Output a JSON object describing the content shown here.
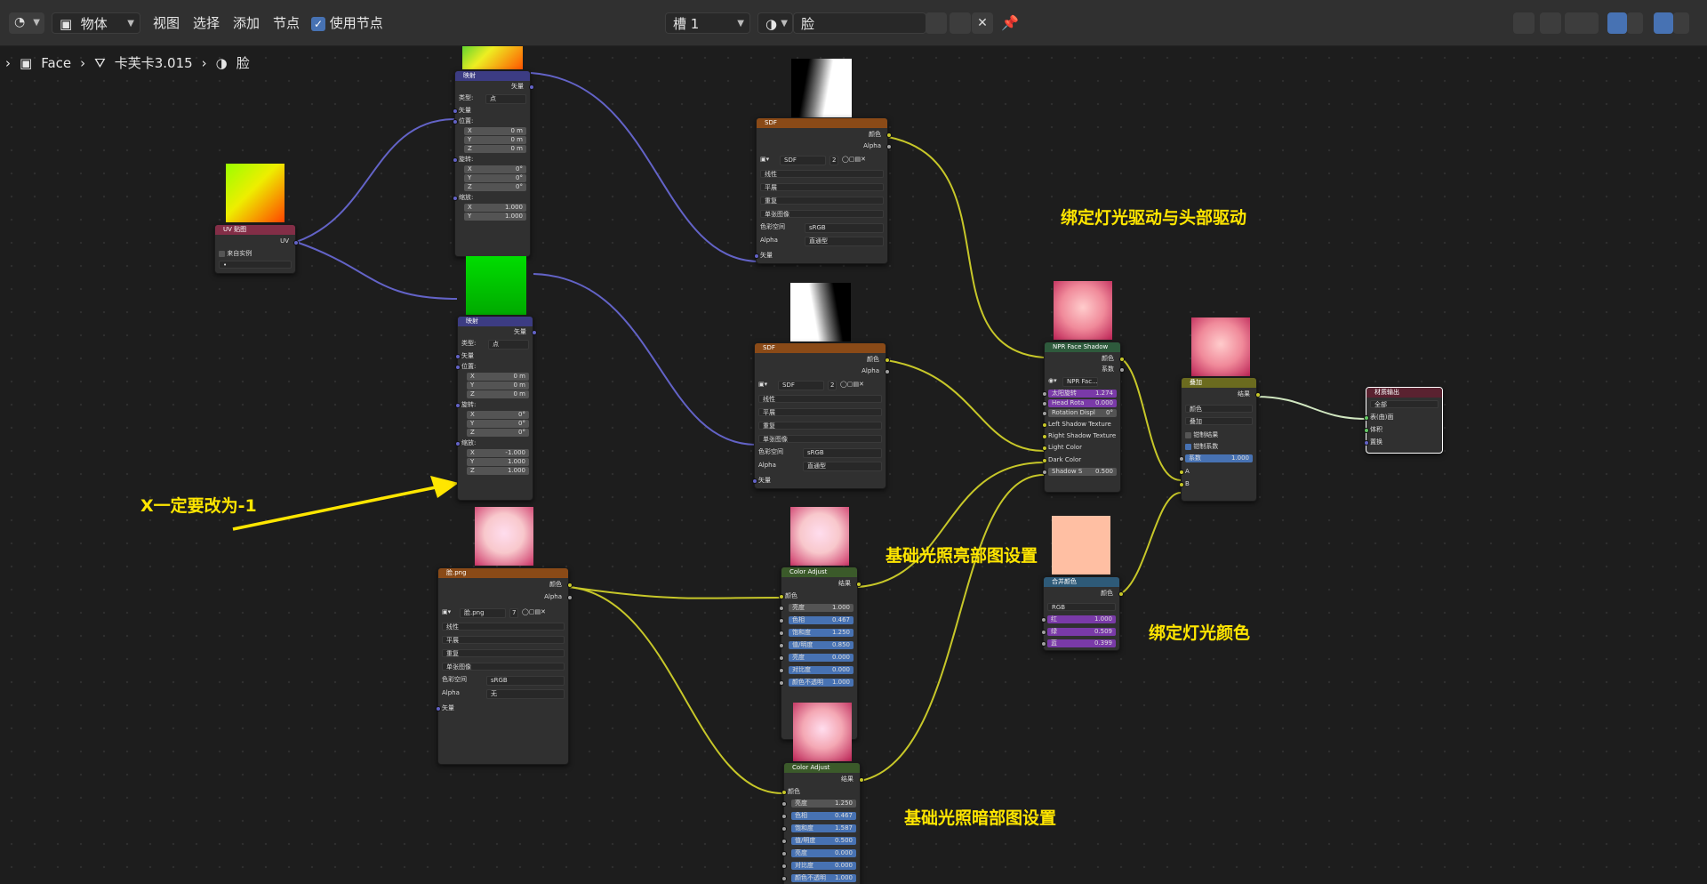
{
  "header": {
    "mode_label": "物体",
    "menu": [
      "视图",
      "选择",
      "添加",
      "节点"
    ],
    "use_nodes_label": "使用节点",
    "slot_label": "槽 1",
    "material_name": "脸"
  },
  "breadcrumb": {
    "object": "Face",
    "mesh": "卡芙卡3.015",
    "material": "脸"
  },
  "nodes": {
    "uvmap": {
      "title": "UV 贴图",
      "output": "UV",
      "checkbox": "来自实例",
      "field": "•"
    },
    "map1": {
      "title": "映射",
      "out": "矢量",
      "type_label": "类型:",
      "type_value": "点",
      "vec": "矢量",
      "loc": "位置:",
      "rot": "旋转:",
      "scale": "缩放:",
      "loc_x": "0 m",
      "loc_y": "0 m",
      "loc_z": "0 m",
      "rot_x": "0°",
      "rot_y": "0°",
      "rot_z": "0°",
      "sc_x": "1.000",
      "sc_y": "1.000",
      "sc_z": "1.000"
    },
    "map2": {
      "title": "映射",
      "out": "矢量",
      "type_label": "类型:",
      "type_value": "点",
      "vec": "矢量",
      "loc": "位置:",
      "rot": "旋转:",
      "scale": "缩放:",
      "loc_x": "0 m",
      "loc_y": "0 m",
      "loc_z": "0 m",
      "rot_x": "0°",
      "rot_y": "0°",
      "rot_z": "0°",
      "sc_x": "-1.000",
      "sc_y": "1.000",
      "sc_z": "1.000"
    },
    "sdf1": {
      "title": "SDF",
      "color": "颜色",
      "alpha": "Alpha",
      "img": "SDF",
      "users": "2",
      "interp": "线性",
      "proj": "平展",
      "ext": "重复",
      "src": "单张图像",
      "cs_label": "色彩空间",
      "cs": "sRGB",
      "alpha_label": "Alpha",
      "alpha_mode": "直通型",
      "vec": "矢量"
    },
    "sdf2": {
      "title": "SDF",
      "color": "颜色",
      "alpha": "Alpha",
      "img": "SDF",
      "users": "2",
      "interp": "线性",
      "proj": "平展",
      "ext": "重复",
      "src": "单张图像",
      "cs_label": "色彩空间",
      "cs": "sRGB",
      "alpha_label": "Alpha",
      "alpha_mode": "直通型",
      "vec": "矢量"
    },
    "facepng": {
      "title": "脸.png",
      "color": "颜色",
      "alpha": "Alpha",
      "img": "脸.png",
      "users": "7",
      "interp": "线性",
      "proj": "平展",
      "ext": "重复",
      "src": "单张图像",
      "cs_label": "色彩空间",
      "cs": "sRGB",
      "alpha_label": "Alpha",
      "alpha_mode": "无",
      "vec": "矢量"
    },
    "ca1": {
      "title": "Color Adjust",
      "out": "结果",
      "in": "颜色",
      "rows": [
        {
          "k": "亮度",
          "v": "1.000"
        },
        {
          "k": "色相",
          "v": "0.467"
        },
        {
          "k": "饱和度",
          "v": "1.250"
        },
        {
          "k": "值/明度",
          "v": "0.850"
        },
        {
          "k": "亮度",
          "v": "0.000"
        },
        {
          "k": "对比度",
          "v": "0.000"
        },
        {
          "k": "颜色不透明",
          "v": "1.000"
        }
      ]
    },
    "ca2": {
      "title": "Color Adjust",
      "out": "结果",
      "in": "颜色",
      "rows": [
        {
          "k": "亮度",
          "v": "1.250"
        },
        {
          "k": "色相",
          "v": "0.467"
        },
        {
          "k": "饱和度",
          "v": "1.587"
        },
        {
          "k": "值/明度",
          "v": "0.500"
        },
        {
          "k": "亮度",
          "v": "0.000"
        },
        {
          "k": "对比度",
          "v": "0.000"
        },
        {
          "k": "颜色不透明",
          "v": "1.000"
        }
      ]
    },
    "npr": {
      "title": "NPR Face Shadow",
      "out1": "颜色",
      "out2": "系数",
      "group": "NPR Fac...",
      "sun_label": "太阳旋转",
      "sun": "1.274",
      "head_label": "Head Rota",
      "head": "0.000",
      "rot_label": "Rotation Displ",
      "rot": "0°",
      "left": "Left Shadow Texture",
      "right": "Right Shadow Texture",
      "light": "Light Color",
      "dark": "Dark Color",
      "shadow_label": "Shadow S",
      "shadow": "0.500"
    },
    "mix": {
      "title": "叠加",
      "out": "结果",
      "mode1": "颜色",
      "mode2": "叠加",
      "clamp_result": "钳制结果",
      "clamp_factor": "钳制系数",
      "factor_label": "系数",
      "factor": "1.000",
      "a": "A",
      "b": "B"
    },
    "combine": {
      "title": "合并颜色",
      "out": "颜色",
      "mode": "RGB",
      "r_label": "红",
      "r": "1.000",
      "g_label": "绿",
      "g": "0.509",
      "b_label": "蓝",
      "b": "0.399"
    },
    "output": {
      "title": "材质输出",
      "target": "全部",
      "surface": "表(曲)面",
      "volume": "体积",
      "disp": "置换"
    }
  },
  "annotations": {
    "bind_light": "绑定灯光驱动与头部驱动",
    "x_minus1": "X一定要改为-1",
    "base_bright": "基础光照亮部图设置",
    "base_dark": "基础光照暗部图设置",
    "bind_color": "绑定灯光颜色"
  },
  "colors": {
    "color_socket": "#c7c729",
    "vector_socket": "#6363c7",
    "annotation": "#ffe600",
    "wire_out": "#d0e6c0"
  }
}
